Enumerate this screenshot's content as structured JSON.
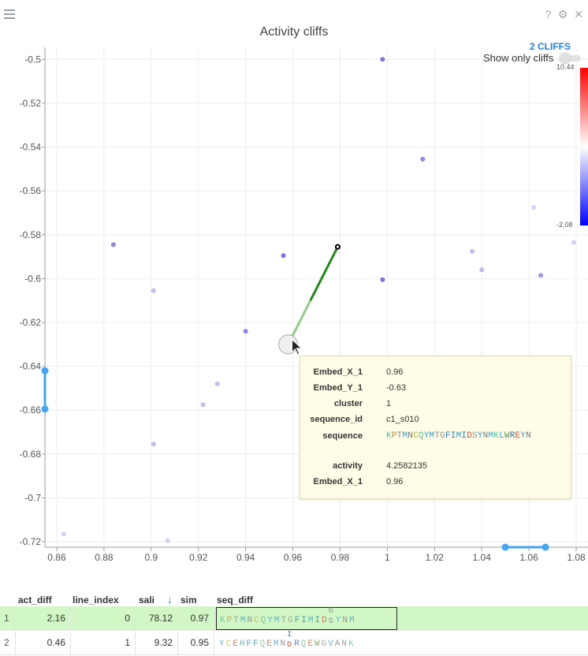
{
  "title": "Activity cliffs",
  "cliffs_label": "2 CLIFFS",
  "show_only_label": "Show only cliffs",
  "colorbar": {
    "max_label": "10.44",
    "min_label": "-2.08"
  },
  "icons": {
    "menu": "menu-icon",
    "help": "help-icon",
    "settings": "gear-icon",
    "close": "close-icon"
  },
  "chart_data": {
    "type": "scatter",
    "title": "",
    "xlim": [
      0.855,
      1.085
    ],
    "ylim": [
      -0.7225,
      -0.4945
    ],
    "x_ticks": [
      0.86,
      0.88,
      0.9,
      0.92,
      0.94,
      0.96,
      0.98,
      1,
      1.02,
      1.04,
      1.06,
      1.08
    ],
    "x_tick_labels": [
      "0.86",
      "0.88",
      "0.9",
      "0.92",
      "0.94",
      "0.96",
      "0.98",
      "1",
      "1.02",
      "1.04",
      "1.06",
      "1.08"
    ],
    "y_ticks": [
      -0.5,
      -0.52,
      -0.54,
      -0.56,
      -0.58,
      -0.6,
      -0.62,
      -0.64,
      -0.66,
      -0.68,
      -0.7,
      -0.72
    ],
    "y_tick_labels": [
      "-0.5",
      "-0.52",
      "-0.54",
      "-0.56",
      "-0.58",
      "-0.6",
      "-0.62",
      "-0.64",
      "-0.66",
      "-0.68",
      "-0.7",
      "-0.72"
    ],
    "points": [
      {
        "x": 0.998,
        "y": -0.5,
        "v": 6
      },
      {
        "x": 1.015,
        "y": -0.5455,
        "v": 5
      },
      {
        "x": 1.062,
        "y": -0.5675,
        "v": 1
      },
      {
        "x": 1.079,
        "y": -0.5835,
        "v": 1
      },
      {
        "x": 0.884,
        "y": -0.5845,
        "v": 5
      },
      {
        "x": 0.956,
        "y": -0.5895,
        "v": 6
      },
      {
        "x": 1.036,
        "y": -0.5875,
        "v": 2
      },
      {
        "x": 1.04,
        "y": -0.596,
        "v": 2
      },
      {
        "x": 0.998,
        "y": -0.6005,
        "v": 6
      },
      {
        "x": 1.065,
        "y": -0.5985,
        "v": 4
      },
      {
        "x": 0.901,
        "y": -0.6055,
        "v": 2
      },
      {
        "x": 0.94,
        "y": -0.624,
        "v": 5
      },
      {
        "x": 0.928,
        "y": -0.648,
        "v": 2
      },
      {
        "x": 0.922,
        "y": -0.6575,
        "v": 2
      },
      {
        "x": 0.901,
        "y": -0.6755,
        "v": 2
      },
      {
        "x": 0.863,
        "y": -0.7165,
        "v": 1
      },
      {
        "x": 0.907,
        "y": -0.7195,
        "v": 1
      },
      {
        "x": 0.979,
        "y": -0.5855,
        "v": 0,
        "highlight": true
      },
      {
        "x": 0.958,
        "y": -0.63,
        "v": 0,
        "hover": true
      }
    ],
    "cliff_lines": [
      {
        "x1": 0.979,
        "y1": -0.5855,
        "x2": 0.958,
        "y2": -0.63,
        "color": "#1e8a14"
      }
    ],
    "grid": true,
    "x_range_slider": [
      1.05,
      1.067
    ],
    "y_range_slider": [
      -0.642,
      -0.6595
    ]
  },
  "tooltip": {
    "rows": [
      {
        "key": "Embed_X_1",
        "value": "0.96"
      },
      {
        "key": "Embed_Y_1",
        "value": "-0.63"
      },
      {
        "key": "cluster",
        "value": "1"
      },
      {
        "key": "sequence_id",
        "value": "c1_s010"
      },
      {
        "key": "sequence",
        "value": "KPTMNCQYMTGFIMIDSYNMKLWREYN"
      },
      {
        "key": "activity",
        "value": "4.2582135"
      },
      {
        "key": "Embed_X_1",
        "value": "0.96"
      }
    ]
  },
  "grid": {
    "columns": [
      "act_diff",
      "line_index",
      "sali",
      "sim",
      "seq_diff"
    ],
    "sort_indicator": "↓",
    "rows": [
      {
        "num": "1",
        "act_diff": "2.16",
        "line_index": "0",
        "sali": "78.12",
        "sim": "0.97",
        "seq_before": "KPTMNCQYMTGFIMID",
        "diff_top": "G",
        "diff_bottom": "S",
        "seq_after": "YNM",
        "selected": true
      },
      {
        "num": "2",
        "act_diff": "0.46",
        "line_index": "1",
        "sali": "9.32",
        "sim": "0.95",
        "seq_before": "YCEHFFQEMN",
        "diff_top": "I",
        "diff_bottom": "D",
        "seq_after": "RQEWGVANK",
        "selected": false
      }
    ]
  }
}
